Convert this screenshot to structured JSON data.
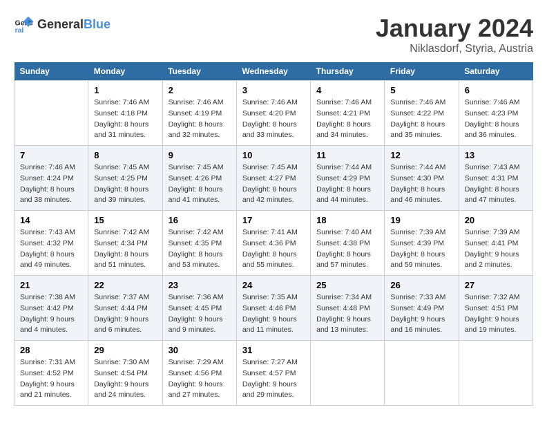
{
  "header": {
    "logo_general": "General",
    "logo_blue": "Blue",
    "month_year": "January 2024",
    "location": "Niklasdorf, Styria, Austria"
  },
  "days_of_week": [
    "Sunday",
    "Monday",
    "Tuesday",
    "Wednesday",
    "Thursday",
    "Friday",
    "Saturday"
  ],
  "weeks": [
    [
      {
        "day": "",
        "info": ""
      },
      {
        "day": "1",
        "info": "Sunrise: 7:46 AM\nSunset: 4:18 PM\nDaylight: 8 hours\nand 31 minutes."
      },
      {
        "day": "2",
        "info": "Sunrise: 7:46 AM\nSunset: 4:19 PM\nDaylight: 8 hours\nand 32 minutes."
      },
      {
        "day": "3",
        "info": "Sunrise: 7:46 AM\nSunset: 4:20 PM\nDaylight: 8 hours\nand 33 minutes."
      },
      {
        "day": "4",
        "info": "Sunrise: 7:46 AM\nSunset: 4:21 PM\nDaylight: 8 hours\nand 34 minutes."
      },
      {
        "day": "5",
        "info": "Sunrise: 7:46 AM\nSunset: 4:22 PM\nDaylight: 8 hours\nand 35 minutes."
      },
      {
        "day": "6",
        "info": "Sunrise: 7:46 AM\nSunset: 4:23 PM\nDaylight: 8 hours\nand 36 minutes."
      }
    ],
    [
      {
        "day": "7",
        "info": "Sunrise: 7:46 AM\nSunset: 4:24 PM\nDaylight: 8 hours\nand 38 minutes."
      },
      {
        "day": "8",
        "info": "Sunrise: 7:45 AM\nSunset: 4:25 PM\nDaylight: 8 hours\nand 39 minutes."
      },
      {
        "day": "9",
        "info": "Sunrise: 7:45 AM\nSunset: 4:26 PM\nDaylight: 8 hours\nand 41 minutes."
      },
      {
        "day": "10",
        "info": "Sunrise: 7:45 AM\nSunset: 4:27 PM\nDaylight: 8 hours\nand 42 minutes."
      },
      {
        "day": "11",
        "info": "Sunrise: 7:44 AM\nSunset: 4:29 PM\nDaylight: 8 hours\nand 44 minutes."
      },
      {
        "day": "12",
        "info": "Sunrise: 7:44 AM\nSunset: 4:30 PM\nDaylight: 8 hours\nand 46 minutes."
      },
      {
        "day": "13",
        "info": "Sunrise: 7:43 AM\nSunset: 4:31 PM\nDaylight: 8 hours\nand 47 minutes."
      }
    ],
    [
      {
        "day": "14",
        "info": "Sunrise: 7:43 AM\nSunset: 4:32 PM\nDaylight: 8 hours\nand 49 minutes."
      },
      {
        "day": "15",
        "info": "Sunrise: 7:42 AM\nSunset: 4:34 PM\nDaylight: 8 hours\nand 51 minutes."
      },
      {
        "day": "16",
        "info": "Sunrise: 7:42 AM\nSunset: 4:35 PM\nDaylight: 8 hours\nand 53 minutes."
      },
      {
        "day": "17",
        "info": "Sunrise: 7:41 AM\nSunset: 4:36 PM\nDaylight: 8 hours\nand 55 minutes."
      },
      {
        "day": "18",
        "info": "Sunrise: 7:40 AM\nSunset: 4:38 PM\nDaylight: 8 hours\nand 57 minutes."
      },
      {
        "day": "19",
        "info": "Sunrise: 7:39 AM\nSunset: 4:39 PM\nDaylight: 8 hours\nand 59 minutes."
      },
      {
        "day": "20",
        "info": "Sunrise: 7:39 AM\nSunset: 4:41 PM\nDaylight: 9 hours\nand 2 minutes."
      }
    ],
    [
      {
        "day": "21",
        "info": "Sunrise: 7:38 AM\nSunset: 4:42 PM\nDaylight: 9 hours\nand 4 minutes."
      },
      {
        "day": "22",
        "info": "Sunrise: 7:37 AM\nSunset: 4:44 PM\nDaylight: 9 hours\nand 6 minutes."
      },
      {
        "day": "23",
        "info": "Sunrise: 7:36 AM\nSunset: 4:45 PM\nDaylight: 9 hours\nand 9 minutes."
      },
      {
        "day": "24",
        "info": "Sunrise: 7:35 AM\nSunset: 4:46 PM\nDaylight: 9 hours\nand 11 minutes."
      },
      {
        "day": "25",
        "info": "Sunrise: 7:34 AM\nSunset: 4:48 PM\nDaylight: 9 hours\nand 13 minutes."
      },
      {
        "day": "26",
        "info": "Sunrise: 7:33 AM\nSunset: 4:49 PM\nDaylight: 9 hours\nand 16 minutes."
      },
      {
        "day": "27",
        "info": "Sunrise: 7:32 AM\nSunset: 4:51 PM\nDaylight: 9 hours\nand 19 minutes."
      }
    ],
    [
      {
        "day": "28",
        "info": "Sunrise: 7:31 AM\nSunset: 4:52 PM\nDaylight: 9 hours\nand 21 minutes."
      },
      {
        "day": "29",
        "info": "Sunrise: 7:30 AM\nSunset: 4:54 PM\nDaylight: 9 hours\nand 24 minutes."
      },
      {
        "day": "30",
        "info": "Sunrise: 7:29 AM\nSunset: 4:56 PM\nDaylight: 9 hours\nand 27 minutes."
      },
      {
        "day": "31",
        "info": "Sunrise: 7:27 AM\nSunset: 4:57 PM\nDaylight: 9 hours\nand 29 minutes."
      },
      {
        "day": "",
        "info": ""
      },
      {
        "day": "",
        "info": ""
      },
      {
        "day": "",
        "info": ""
      }
    ]
  ]
}
